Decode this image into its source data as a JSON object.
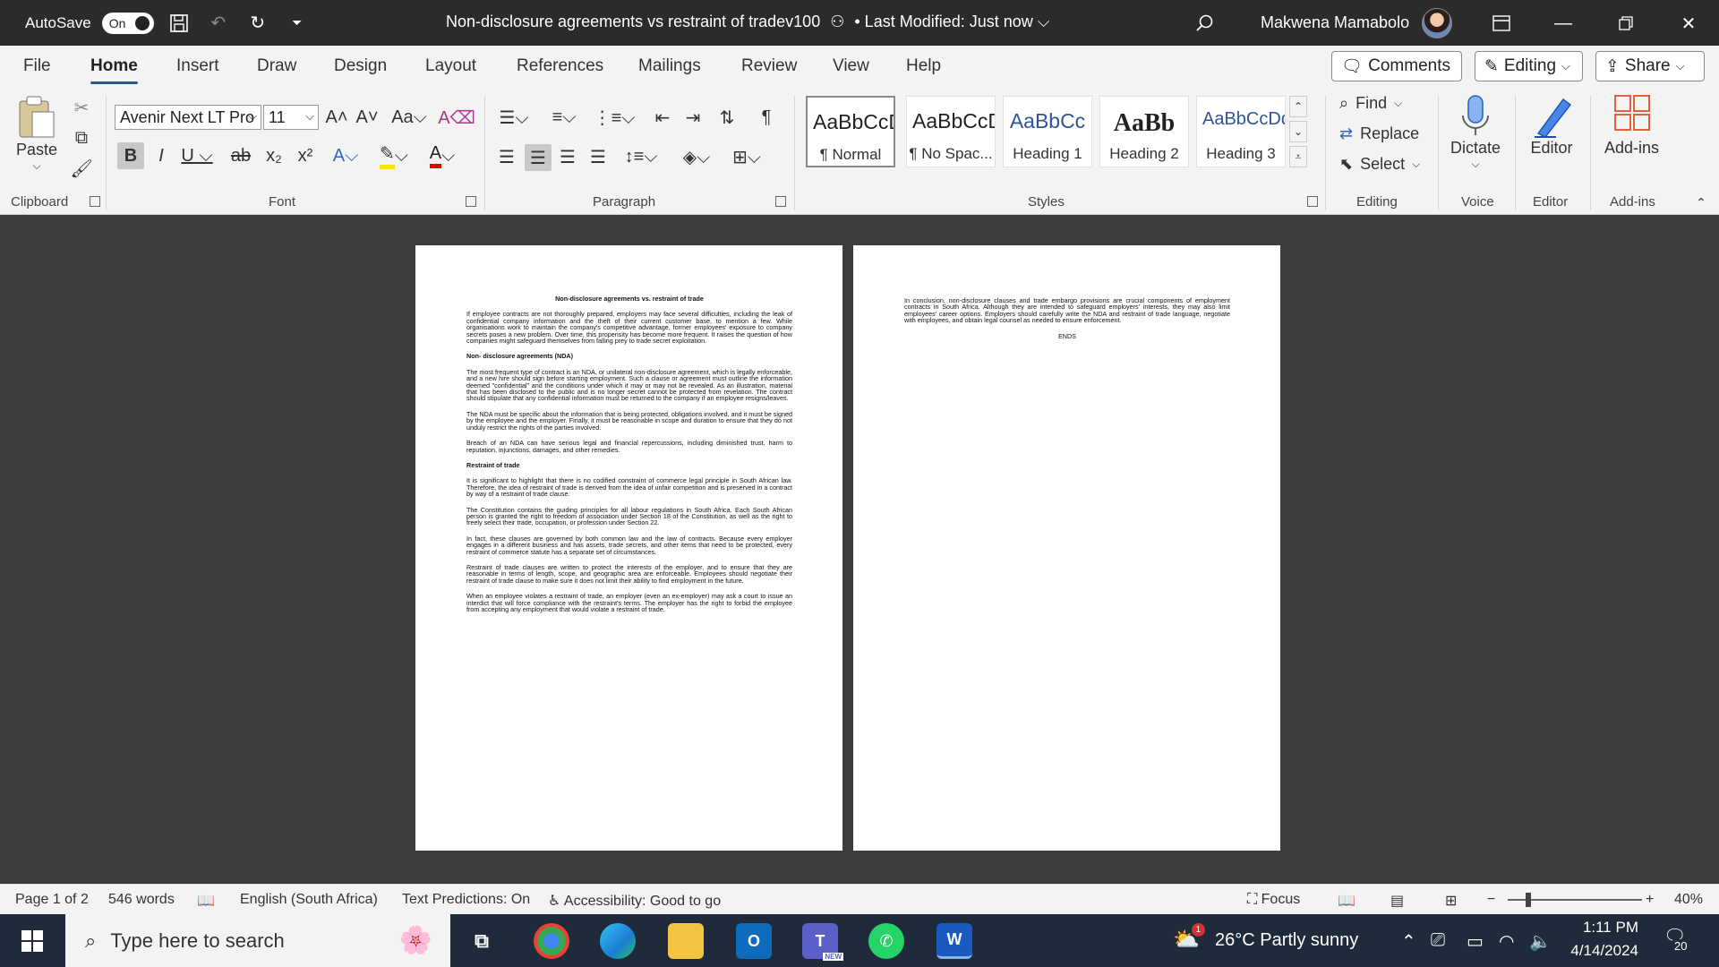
{
  "titlebar": {
    "autosave_label": "AutoSave",
    "autosave_state": "On",
    "doc_title": "Non-disclosure agreements vs restraint of tradev100",
    "modified": "• Last Modified: Just now",
    "user_name": "Makwena Mamabolo"
  },
  "tabs": [
    "File",
    "Home",
    "Insert",
    "Draw",
    "Design",
    "Layout",
    "References",
    "Mailings",
    "Review",
    "View",
    "Help"
  ],
  "top_buttons": {
    "comments": "Comments",
    "editing": "Editing",
    "share": "Share"
  },
  "ribbon": {
    "clipboard": {
      "paste": "Paste",
      "label": "Clipboard"
    },
    "font": {
      "name": "Avenir Next LT Pro",
      "size": "11",
      "label": "Font"
    },
    "paragraph": {
      "label": "Paragraph"
    },
    "styles": {
      "label": "Styles",
      "items": [
        {
          "sample": "AaBbCcDd",
          "name": "¶ Normal"
        },
        {
          "sample": "AaBbCcDd",
          "name": "¶ No Spac..."
        },
        {
          "sample": "AaBbCc",
          "name": "Heading 1"
        },
        {
          "sample": "AaBb",
          "name": "Heading 2"
        },
        {
          "sample": "AaBbCcDd",
          "name": "Heading 3"
        }
      ]
    },
    "editing": {
      "label": "Editing",
      "find": "Find",
      "replace": "Replace",
      "select": "Select"
    },
    "voice": {
      "label": "Voice",
      "dictate": "Dictate"
    },
    "editor": {
      "label": "Editor",
      "button": "Editor"
    },
    "addins": {
      "label": "Add-ins",
      "button": "Add-ins"
    }
  },
  "document": {
    "page1": {
      "title": "Non-disclosure agreements vs. restraint of trade",
      "p1": "If employee contracts are not thoroughly prepared, employers may face several difficulties, including the leak of confidential company information and the theft of their current customer base, to mention a few. While organisations work to maintain the company's competitive advantage, former employees' exposure to company secrets poses a new problem. Over time, this propensity has become more frequent. It raises the question of how companies might safeguard themselves from falling prey to trade secret exploitation.",
      "h1": "Non- disclosure agreements (NDA)",
      "p2": "The most frequent type of contract is an NDA, or unilateral non-disclosure agreement, which is legally enforceable, and a new hire should sign before starting employment. Such a clause or agreement must outline the information deemed \"confidential\" and the conditions under which it may or may not be revealed. As an illustration, material that has been disclosed to the public and is no longer secret cannot be protected from revelation. The contract should stipulate that any confidential information must be returned to the company if an employee resigns/leaves.",
      "p3": "The NDA must be specific about the information that is being protected, obligations involved, and it must be signed by the employee and the employer. Finally, it must be reasonable in scope and duration to ensure that they do not unduly restrict the rights of the parties involved.",
      "p4": "Breach of an NDA can have serious legal and financial repercussions, including diminished trust, harm to reputation, injunctions, damages, and other remedies.",
      "h2": "Restraint of trade",
      "p5": "It is significant to highlight that there is no codified constraint of commerce legal principle in South African law. Therefore, the idea of restraint of trade is derived from the idea of unfair competition and is preserved in a contract by way of a restraint of trade clause.",
      "p6": "The Constitution contains the guiding principles for all labour regulations in South Africa. Each South African person is granted the right to freedom of association under Section 18 of the Constitution, as well as the right to freely select their trade, occupation, or profession under Section 22.",
      "p7": "In fact, these clauses are governed by both common law and the law of contracts. Because every employer engages in a different business and has assets, trade secrets, and other items that need to be protected, every restraint of commerce statute has a separate set of circumstances.",
      "p8": "Restraint of trade clauses are written to protect the interests of the employer, and to ensure that they are reasonable in terms of length, scope, and geographic area are enforceable. Employees should negotiate their restraint of trade clause to make sure it does not limit their ability to find employment in the future.",
      "p9": "When an employee violates a restraint of trade, an employer (even an ex-employer) may ask a court to issue an interdict that will force compliance with the restraint's terms. The employer has the right to forbid the employee from accepting any employment that would violate a restraint of trade."
    },
    "page2": {
      "p1": "In conclusion, non-disclosure clauses and trade embargo provisions are crucial components of employment contracts in South Africa. Although they are intended to safeguard employers' interests, they may also limit employees' career options. Employers should carefully write the NDA and restraint of trade language, negotiate with employees, and obtain legal counsel as needed to ensure enforcement.",
      "ends": "ENDS"
    }
  },
  "statusbar": {
    "page": "Page 1 of 2",
    "words": "546 words",
    "language": "English (South Africa)",
    "predictions": "Text Predictions: On",
    "accessibility": "Accessibility: Good to go",
    "focus": "Focus",
    "zoom": "40%"
  },
  "taskbar": {
    "search_placeholder": "Type here to search",
    "weather": "26°C  Partly sunny",
    "weather_badge": "1",
    "time": "1:11 PM",
    "date": "4/14/2024",
    "notifications": "20",
    "teams_badge": "NEW"
  },
  "colors": {
    "accent": "#2b5797",
    "word_blue": "#185abd",
    "doc_bg": "#3c3c3c",
    "ribbon_bg": "#f3f3f3",
    "taskbar_bg": "#1f2b3a"
  }
}
